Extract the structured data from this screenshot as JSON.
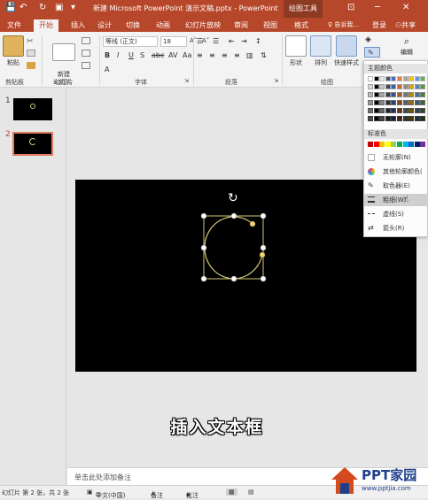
{
  "titlebar": {
    "title": "新建 Microsoft PowerPoint 演示文稿.pptx - PowerPoint",
    "context_tab": "绘图工具"
  },
  "tabs": {
    "file": "文件",
    "home": "开始",
    "insert": "插入",
    "design": "设计",
    "transitions": "切换",
    "animations": "动画",
    "slideshow": "幻灯片放映",
    "review": "审阅",
    "view": "视图",
    "format": "格式",
    "tellme": "告诉我...",
    "signin": "登录",
    "share": "共享"
  },
  "ribbon": {
    "paste": "粘贴",
    "clipboard_group": "剪贴板",
    "new_slide": "新建\n幻灯片",
    "slides_group": "幻灯片",
    "font_name": "等线 (正文)",
    "font_size": "18",
    "font_group": "字体",
    "paragraph_group": "段落",
    "shapes": "形状",
    "arrange": "排列",
    "quick_styles": "快速样式",
    "drawing_group": "绘图",
    "editing": "编辑"
  },
  "slides": {
    "items": [
      {
        "num": "1"
      },
      {
        "num": "2"
      }
    ]
  },
  "canvas": {
    "caption": "插入文本框",
    "notes_placeholder": "单击此处添加备注"
  },
  "status": {
    "slide_info": "幻灯片 第 2 张，共 2 张",
    "language": "中文(中国)",
    "notes": "备注",
    "comments": "批注"
  },
  "dropdown": {
    "theme_colors": "主题颜色",
    "standard_colors": "标准色",
    "no_outline": "无轮廓(N)",
    "more_colors": "其他轮廓颜色(",
    "eyedropper": "取色器(E)",
    "weight": "粗细(W)",
    "dashes": "虚线(S)",
    "arrows": "箭头(R)"
  },
  "watermark": {
    "main": "PPT家园",
    "url": "www.pptjia.com"
  },
  "colors": {
    "accent": "#b7472a",
    "shape_outline": "#d4c77a"
  }
}
